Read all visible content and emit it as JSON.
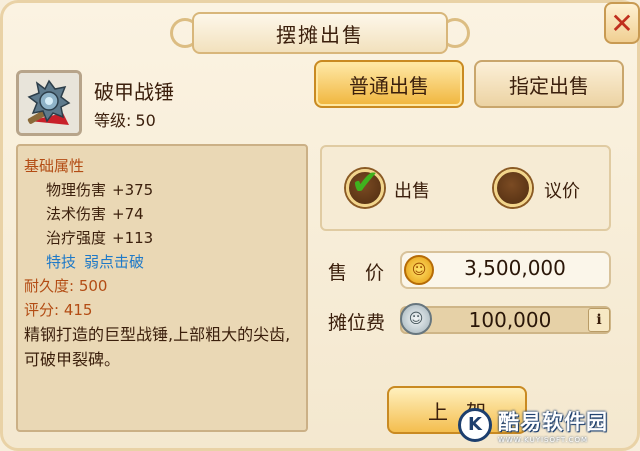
{
  "window": {
    "title": "摆摊出售",
    "close_icon": "close-x-icon"
  },
  "item": {
    "icon": "spiked-war-hammer-icon",
    "name": "破甲战锤",
    "level_label": "等级:",
    "level_value": "50"
  },
  "attributes": {
    "header": "基础属性",
    "stats": [
      {
        "label": "物理伤害",
        "value": "+375"
      },
      {
        "label": "法术伤害",
        "value": "+74"
      },
      {
        "label": "治疗强度",
        "value": "+113"
      }
    ],
    "skill_label": "特技",
    "skill_value": "弱点击破",
    "durability": "耐久度: 500",
    "score": "评分: 415",
    "description": "精钢打造的巨型战锤,上部粗大的尖齿,可破甲裂碑。"
  },
  "tabs": {
    "normal": "普通出售",
    "designated": "指定出售",
    "active": "normal"
  },
  "sale_mode": {
    "sell_label": "出售",
    "bargain_label": "议价",
    "selected": "sell"
  },
  "price": {
    "label": "售 价",
    "value": "3,500,000",
    "coin": "gold-coin-icon"
  },
  "fee": {
    "label": "摊位费",
    "value": "100,000",
    "coin": "silver-coin-icon",
    "info": "i"
  },
  "actions": {
    "list_button": "上架"
  },
  "watermark": {
    "logo": "K",
    "main": "酷易软件园",
    "sub": "WWW.KUYISOFT.COM"
  },
  "colors": {
    "accent_gold": "#f0b53c",
    "check_green": "#3fb21e",
    "skill_blue": "#1e79c8",
    "header_orange": "#b34c14",
    "close_red": "#c0301f"
  }
}
